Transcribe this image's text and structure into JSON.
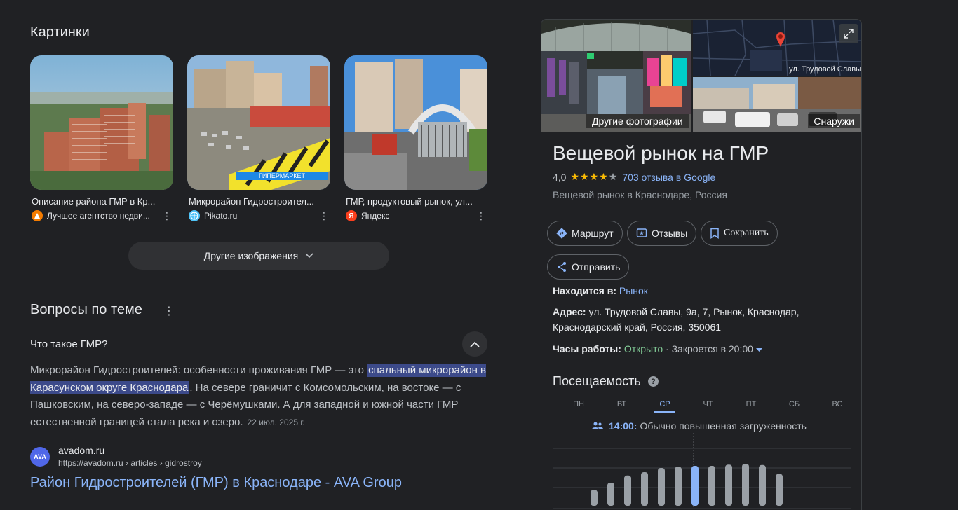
{
  "images_section": {
    "title": "Картинки",
    "cards": [
      {
        "caption": "Описание района ГМР в Кр...",
        "source": "Лучшее агентство недви...",
        "source_icon": "agency-logo-icon",
        "source_color": "#f57c00"
      },
      {
        "caption": "Микрорайон Гидростроител...",
        "source": "Pikato.ru",
        "source_icon": "pikato-logo-icon",
        "source_color": "#4fc3f7"
      },
      {
        "caption": "ГМР, продуктовый рынок, ул...",
        "source": "Яндекс",
        "source_icon": "yandex-logo-icon",
        "source_color": "#fc3f1d",
        "source_glyph": "Я"
      }
    ],
    "thumb_texts": [
      "ГИПЕРМАРКЕТ"
    ],
    "more_label": "Другие изображения"
  },
  "qa_section": {
    "title": "Вопросы по теме",
    "question": "Что такое ГМР?",
    "answer_before": "Микрорайон Гидростроителей: особенности проживания ГМР — это ",
    "answer_highlight": "спальный микрорайон в Карасунском округе Краснодара",
    "answer_after": ". На севере граничит с Комсомольским, на востоке — с Пашковским, на северо-западе — с Черёмушками. А для западной и южной части ГМР естественной границей стала река и озеро.",
    "date": "22 июл. 2025 г.",
    "source_fav": "AVA",
    "source_name": "avadom.ru",
    "source_url": "https://avadom.ru › articles › gidrostroy",
    "result_title": "Район Гидростроителей (ГМР) в Краснодаре - AVA Group"
  },
  "place_panel": {
    "photo_labels": {
      "more_photos": "Другие фотографии",
      "outside": "Снаружи"
    },
    "map_street": "ул. Трудовой Славы",
    "title": "Вещевой рынок на ГМР",
    "rating": "4,0",
    "stars_filled": 4,
    "stars_total": 5,
    "reviews_link": "703 отзыва в Google",
    "type": "Вещевой рынок в Краснодаре, Россия",
    "buttons": {
      "route": "Маршрут",
      "reviews": "Отзывы",
      "save": "Сохранить",
      "share": "Отправить"
    },
    "located_label": "Находится в:",
    "located_value": "Рынок",
    "address_label": "Адрес:",
    "address_line1": "ул. Трудовой Славы, 9а, 7, Рынок, Краснодар,",
    "address_line2": "Краснодарский край, Россия, 350061",
    "hours_label": "Часы работы:",
    "hours_status": "Открыто",
    "hours_detail": "· Закроется в 20:00",
    "popular_title": "Посещаемость",
    "days": [
      "ПН",
      "ВТ",
      "СР",
      "ЧТ",
      "ПТ",
      "СБ",
      "ВС"
    ],
    "active_day": 2,
    "busy_time": "14:00:",
    "busy_text": "Обычно повышенная загруженность",
    "colors": {
      "accent": "#8ab4f8",
      "open": "#81c995",
      "star": "#fbbc04"
    }
  },
  "chart_data": {
    "type": "bar",
    "values": [
      0.38,
      0.55,
      0.72,
      0.8,
      0.9,
      0.93,
      0.95,
      0.95,
      0.98,
      1.0,
      0.97,
      0.76
    ],
    "highlight_index": 6
  }
}
